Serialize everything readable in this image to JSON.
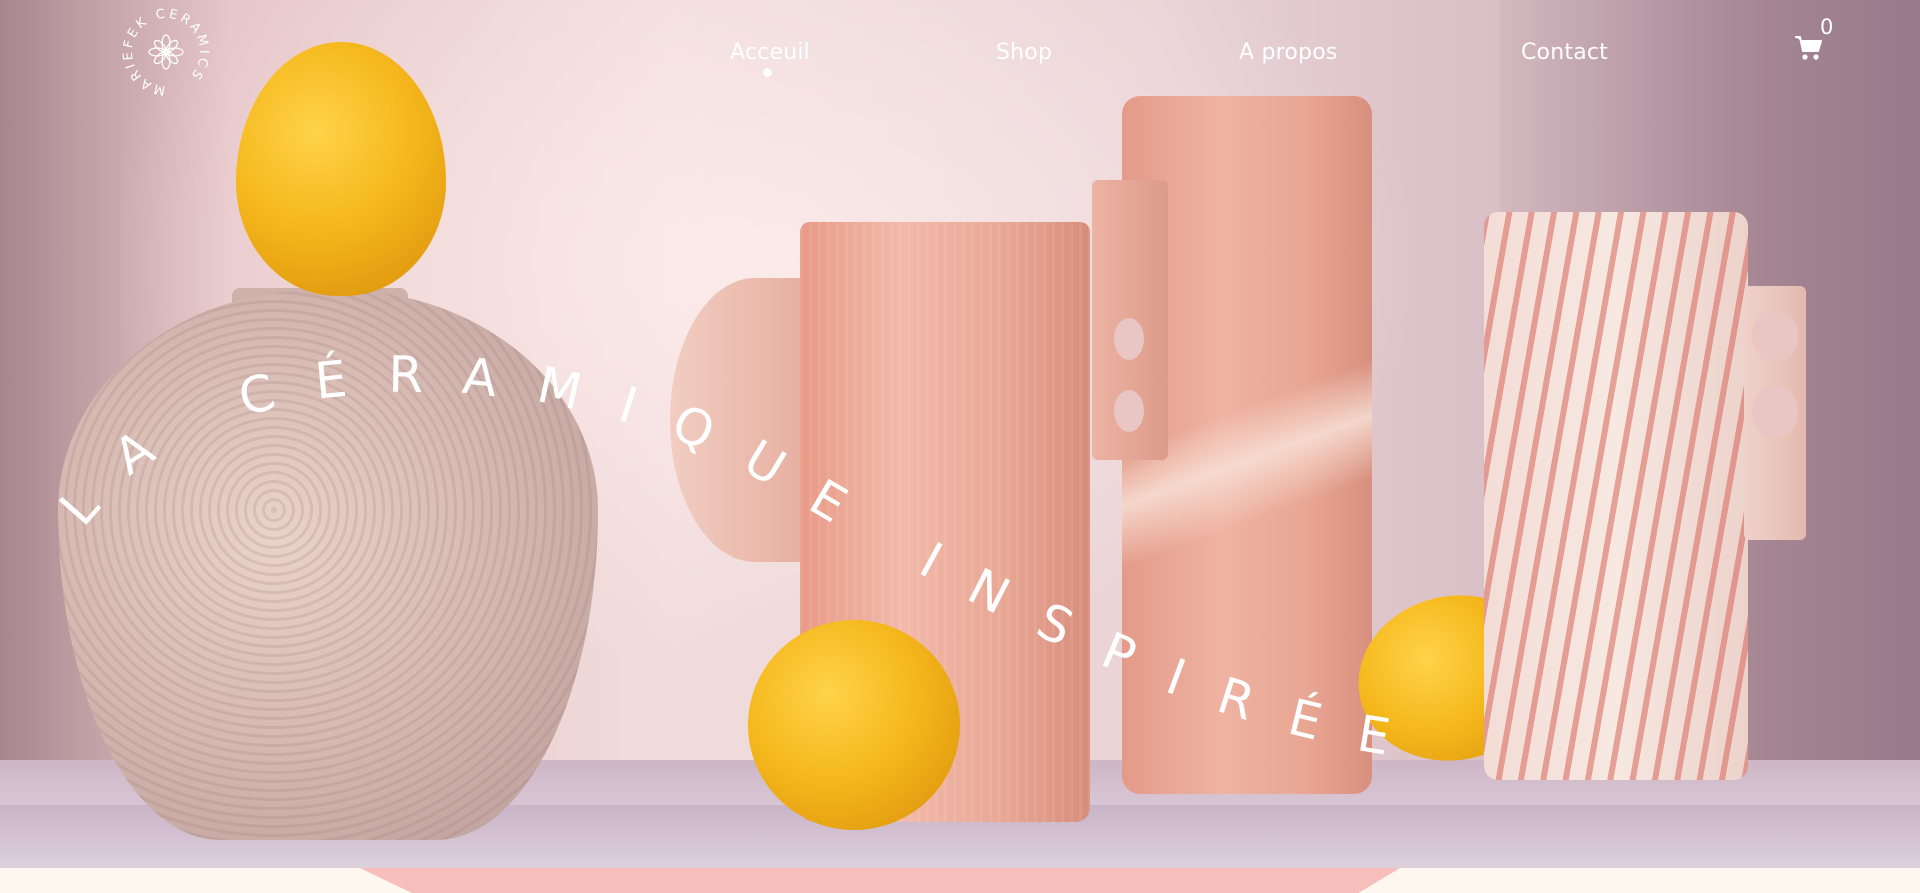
{
  "brand": {
    "name": "MARIEFEK CERAMICS",
    "logo_icon": "flower-icon"
  },
  "nav": {
    "items": [
      {
        "label": "Acceuil",
        "active": true
      },
      {
        "label": "Shop",
        "active": false
      },
      {
        "label": "A propos",
        "active": false
      },
      {
        "label": "Contact",
        "active": false
      }
    ]
  },
  "cart": {
    "icon": "cart-icon",
    "count": "0"
  },
  "hero": {
    "headline": "LA CÉRAMIQUE INSPIRÉE"
  },
  "colors": {
    "nav_text": "#ffffff",
    "headline": "#ffffff",
    "page_background": "#fdf7ef",
    "accent_pink": "#f6bfbb"
  }
}
